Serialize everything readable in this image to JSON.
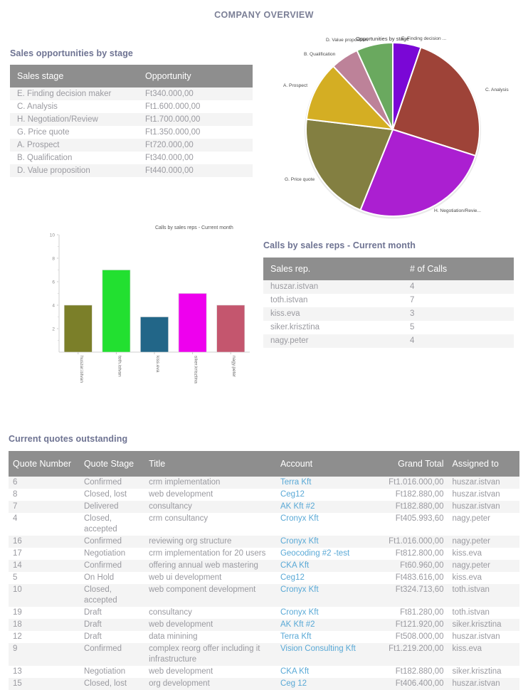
{
  "page": {
    "title": "COMPANY OVERVIEW"
  },
  "sales_opportunities": {
    "heading": "Sales opportunities by stage",
    "columns": [
      "Sales stage",
      "Opportunity"
    ],
    "rows": [
      [
        "E. Finding decision maker",
        "Ft340.000,00"
      ],
      [
        "C. Analysis",
        "Ft1.600.000,00"
      ],
      [
        "H. Negotiation/Review",
        "Ft1.700.000,00"
      ],
      [
        "G. Price quote",
        "Ft1.350.000,00"
      ],
      [
        "A. Prospect",
        "Ft720.000,00"
      ],
      [
        "B. Qualification",
        "Ft340.000,00"
      ],
      [
        "D. Value proposition",
        "Ft440.000,00"
      ]
    ]
  },
  "calls": {
    "heading": "Calls by sales reps - Current month",
    "columns": [
      "Sales rep.",
      "# of Calls"
    ],
    "rows": [
      [
        "huszar.istvan",
        "4"
      ],
      [
        "toth.istvan",
        "7"
      ],
      [
        "kiss.eva",
        "3"
      ],
      [
        "siker.krisztina",
        "5"
      ],
      [
        "nagy.peter",
        "4"
      ]
    ]
  },
  "quotes": {
    "heading": "Current quotes outstanding",
    "columns": [
      "Quote Number",
      "Quote Stage",
      "Title",
      "Account",
      "Grand Total",
      "Assigned to"
    ],
    "rows": [
      [
        "6",
        "Confirmed",
        "crm implementation",
        "Terra Kft",
        "Ft1.016.000,00",
        "huszar.istvan"
      ],
      [
        "8",
        "Closed, lost",
        "web development",
        "Ceg12",
        "Ft182.880,00",
        "huszar.istvan"
      ],
      [
        "7",
        "Delivered",
        "consultancy",
        "AK Kft #2",
        "Ft182.880,00",
        "huszar.istvan"
      ],
      [
        "4",
        "Closed, accepted",
        "crm consultancy",
        "Cronyx Kft",
        "Ft405.993,60",
        "nagy.peter"
      ],
      [
        "16",
        "Confirmed",
        "reviewing org structure",
        "Cronyx Kft",
        "Ft1.016.000,00",
        "nagy.peter"
      ],
      [
        "17",
        "Negotiation",
        "crm implementation for 20 users",
        "Geocoding #2 -test",
        "Ft812.800,00",
        "kiss.eva"
      ],
      [
        "14",
        "Confirmed",
        "offering annual web mastering",
        "CKA Kft",
        "Ft60.960,00",
        "nagy.peter"
      ],
      [
        "5",
        "On Hold",
        "web ui development",
        "Ceg12",
        "Ft483.616,00",
        "kiss.eva"
      ],
      [
        "10",
        "Closed, accepted",
        "web component development",
        "Cronyx Kft",
        "Ft324.713,60",
        "toth.istvan"
      ],
      [
        "19",
        "Draft",
        "consultancy",
        "Cronyx Kft",
        "Ft81.280,00",
        "toth.istvan"
      ],
      [
        "18",
        "Draft",
        "web development",
        "AK Kft #2",
        "Ft121.920,00",
        "siker.krisztina"
      ],
      [
        "12",
        "Draft",
        "data minining",
        "Terra Kft",
        "Ft508.000,00",
        "huszar.istvan"
      ],
      [
        "9",
        "Confirmed",
        "complex reorg offer including it infrastructure",
        "Vision Consulting Kft",
        "Ft1.219.200,00",
        "kiss.eva"
      ],
      [
        "13",
        "Negotiation",
        "web development",
        "CKA Kft",
        "Ft182.880,00",
        "siker.krisztina"
      ],
      [
        "15",
        "Closed, lost",
        "org development",
        "Ceg 12",
        "Ft406.400,00",
        "huszar.istvan"
      ]
    ]
  },
  "chart_data": [
    {
      "id": "pie",
      "type": "pie",
      "title": "Opportunities by stage",
      "legend_position": "outside-labels",
      "labels": [
        "E. Finding decision ...",
        "C. Analysis",
        "H. Negotiation/Revie...",
        "G. Price quote",
        "A. Prospect",
        "B. Qualification",
        "D. Value proposition"
      ],
      "values": [
        340000,
        1600000,
        1700000,
        1350000,
        720000,
        340000,
        440000
      ],
      "colors": [
        "#7a07d6",
        "#9e4338",
        "#ab1fd1",
        "#837f41",
        "#d4ae23",
        "#bd8299",
        "#6aa95f"
      ]
    },
    {
      "id": "bar",
      "type": "bar",
      "title": "Calls by sales reps - Current month",
      "categories": [
        "huszar.istvan",
        "toth.istvan",
        "kiss.eva",
        "siker.krisztina",
        "nagy.peter"
      ],
      "values": [
        4,
        7,
        3,
        5,
        4
      ],
      "xlabel": "",
      "ylabel": "",
      "ylim": [
        0,
        10
      ],
      "yticks": [
        10,
        8,
        6,
        4,
        2
      ],
      "grid": false,
      "colors": [
        "#7b7f29",
        "#22e030",
        "#226688",
        "#ee00ee",
        "#c4566e"
      ]
    }
  ]
}
